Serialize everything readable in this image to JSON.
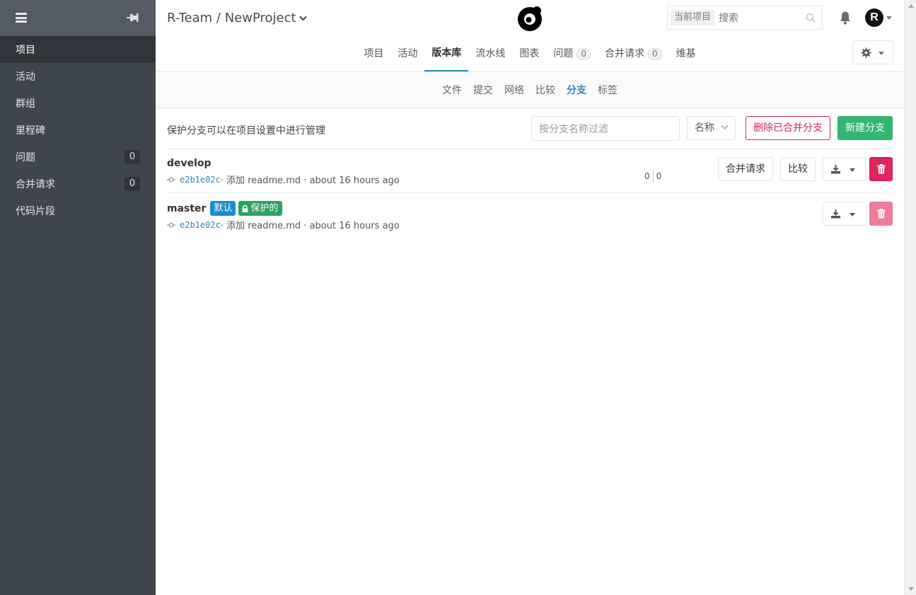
{
  "sidebar": {
    "items": [
      {
        "label": "项目",
        "active": true
      },
      {
        "label": "活动"
      },
      {
        "label": "群组"
      },
      {
        "label": "里程碑"
      },
      {
        "label": "问题",
        "count": "0"
      },
      {
        "label": "合并请求",
        "count": "0"
      },
      {
        "label": "代码片段"
      }
    ]
  },
  "header": {
    "breadcrumb": "R-Team / NewProject",
    "search_scope": "当前项目",
    "search_placeholder": "搜索",
    "avatar_letter": "R"
  },
  "tabs": [
    {
      "label": "项目"
    },
    {
      "label": "活动"
    },
    {
      "label": "版本库",
      "active": true
    },
    {
      "label": "流水线"
    },
    {
      "label": "图表"
    },
    {
      "label": "问题",
      "count": "0"
    },
    {
      "label": "合并请求",
      "count": "0"
    },
    {
      "label": "维基"
    }
  ],
  "subnav": [
    {
      "label": "文件"
    },
    {
      "label": "提交"
    },
    {
      "label": "网络"
    },
    {
      "label": "比较"
    },
    {
      "label": "分支",
      "active": true
    },
    {
      "label": "标签"
    }
  ],
  "toolbar": {
    "hint": "保护分支可以在项目设置中进行管理",
    "filter_placeholder": "按分支名称过滤",
    "sort_label": "名称",
    "delete_merged_label": "删除已合并分支",
    "new_branch_label": "新建分支"
  },
  "branches": [
    {
      "name": "develop",
      "sha": "e2b1e02c",
      "message": "· 添加 readme.md · about 16 hours ago",
      "behind": "0",
      "ahead": "0",
      "merge_request_label": "合并请求",
      "compare_label": "比较"
    },
    {
      "name": "master",
      "default_label": "默认",
      "protected_label": "保护的",
      "sha": "e2b1e02c",
      "message": "· 添加 readme.md · about 16 hours ago"
    }
  ],
  "colors": {
    "sidebar_bg": "#3f454d",
    "accent": "#3084bb",
    "danger": "#d22852",
    "success": "#33b672"
  }
}
